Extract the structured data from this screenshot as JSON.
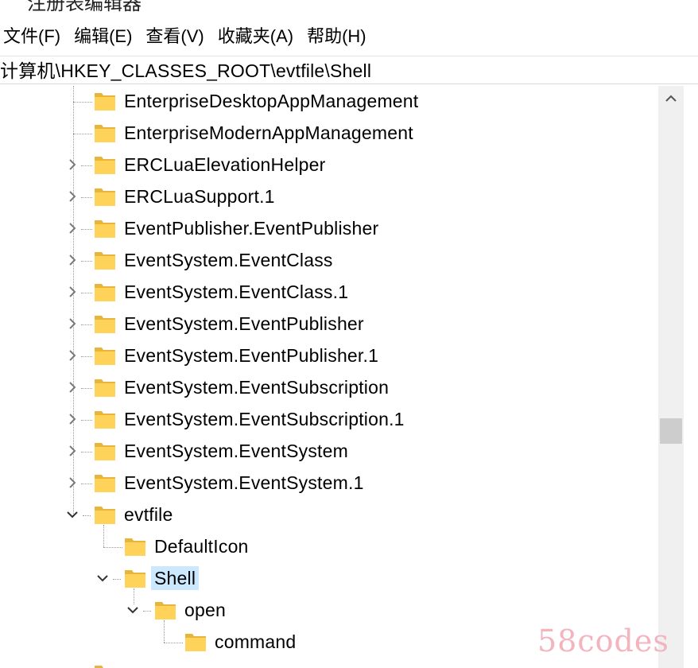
{
  "window": {
    "title": "注册表编辑器"
  },
  "menu": [
    {
      "label": "文件(F)"
    },
    {
      "label": "编辑(E)"
    },
    {
      "label": "查看(V)"
    },
    {
      "label": "收藏夹(A)"
    },
    {
      "label": "帮助(H)"
    }
  ],
  "address": {
    "path": "计算机\\HKEY_CLASSES_ROOT\\evtfile\\Shell"
  },
  "tree": {
    "items": [
      {
        "label": "EnterpriseDesktopAppManagement",
        "expander": "none"
      },
      {
        "label": "EnterpriseModernAppManagement",
        "expander": "none"
      },
      {
        "label": "ERCLuaElevationHelper",
        "expander": "collapsed"
      },
      {
        "label": "ERCLuaSupport.1",
        "expander": "collapsed"
      },
      {
        "label": "EventPublisher.EventPublisher",
        "expander": "collapsed"
      },
      {
        "label": "EventSystem.EventClass",
        "expander": "collapsed"
      },
      {
        "label": "EventSystem.EventClass.1",
        "expander": "collapsed"
      },
      {
        "label": "EventSystem.EventPublisher",
        "expander": "collapsed"
      },
      {
        "label": "EventSystem.EventPublisher.1",
        "expander": "collapsed"
      },
      {
        "label": "EventSystem.EventSubscription",
        "expander": "collapsed"
      },
      {
        "label": "EventSystem.EventSubscription.1",
        "expander": "collapsed"
      },
      {
        "label": "EventSystem.EventSystem",
        "expander": "collapsed"
      },
      {
        "label": "EventSystem.EventSystem.1",
        "expander": "collapsed"
      },
      {
        "label": "evtfile",
        "expander": "expanded"
      },
      {
        "label": "DefaultIcon",
        "expander": "none"
      },
      {
        "label": "Shell",
        "expander": "expanded",
        "selected": true
      },
      {
        "label": "open",
        "expander": "expanded"
      },
      {
        "label": "command",
        "expander": "none"
      },
      {
        "label": "",
        "expander": "none"
      }
    ]
  },
  "colors": {
    "selection": "#cce8ff",
    "folder": "#ffd35a",
    "watermark": "#f3b4be"
  },
  "watermark": {
    "text": "58codes"
  }
}
